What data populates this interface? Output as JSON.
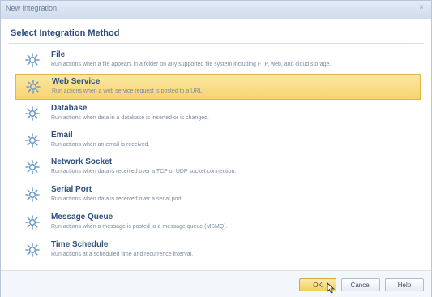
{
  "window": {
    "title": "New Integration",
    "close_glyph": "×"
  },
  "section": {
    "title": "Select Integration Method"
  },
  "items": [
    {
      "name": "File",
      "description": "Run actions when a file appears in a folder on any supported file system including FTP, web, and cloud storage.",
      "icon": "gear-icon"
    },
    {
      "name": "Web Service",
      "description": "Run actions when a web service request is posted to a URL.",
      "icon": "gear-icon"
    },
    {
      "name": "Database",
      "description": "Run actions when data in a database is inserted or is changed.",
      "icon": "gear-icon"
    },
    {
      "name": "Email",
      "description": "Run actions when an email is received.",
      "icon": "gear-icon"
    },
    {
      "name": "Network Socket",
      "description": "Run actions when data is received over a TCP or UDP socket connection.",
      "icon": "gear-icon"
    },
    {
      "name": "Serial Port",
      "description": "Run actions when data is received over a serial port.",
      "icon": "gear-icon"
    },
    {
      "name": "Message Queue",
      "description": "Run actions when a message is posted to a message queue (MSMQ).",
      "icon": "gear-icon"
    },
    {
      "name": "Time Schedule",
      "description": "Run actions at a scheduled time and recurrence interval.",
      "icon": "gear-icon"
    }
  ],
  "selected_item": "Web Service",
  "buttons": {
    "ok": "OK",
    "cancel": "Cancel",
    "help": "Help"
  },
  "colors": {
    "accent_selected": "#f7d46c",
    "title_text": "#2e4f7e",
    "gear_icon": "#6e9ccc"
  }
}
